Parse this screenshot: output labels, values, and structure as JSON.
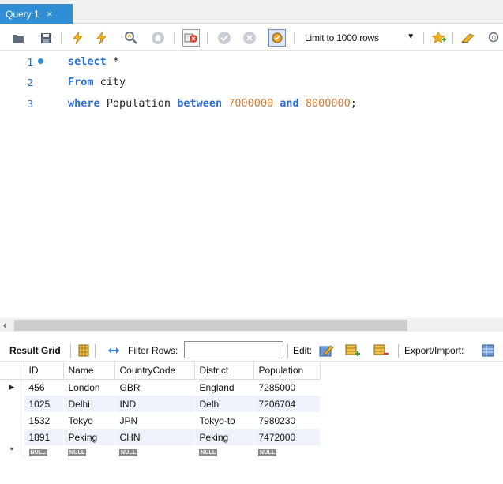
{
  "tabs": [
    {
      "label": "Query 1",
      "close": "×"
    }
  ],
  "toolbar": {
    "limit_label": "Limit to 1000 rows",
    "icons": [
      "folder-icon",
      "save-icon",
      "execute-icon",
      "execute-current-icon",
      "explain-icon",
      "stop-icon",
      "toggle-error-icon",
      "commit-icon",
      "rollback-icon",
      "autocommit-icon",
      "bookmark-icon",
      "beautify-icon",
      "find-icon"
    ]
  },
  "editor": {
    "lines": [
      {
        "num": "1",
        "tokens": [
          {
            "t": "select",
            "k": "kw"
          },
          {
            "t": " *",
            "k": "txt"
          }
        ]
      },
      {
        "num": "2",
        "tokens": [
          {
            "t": "From",
            "k": "kw"
          },
          {
            "t": " city",
            "k": "txt"
          }
        ]
      },
      {
        "num": "3",
        "tokens": [
          {
            "t": "where",
            "k": "kw"
          },
          {
            "t": " Population ",
            "k": "txt"
          },
          {
            "t": "between",
            "k": "kw"
          },
          {
            "t": " ",
            "k": "txt"
          },
          {
            "t": "7000000",
            "k": "num"
          },
          {
            "t": " ",
            "k": "txt"
          },
          {
            "t": "and",
            "k": "kw"
          },
          {
            "t": " ",
            "k": "txt"
          },
          {
            "t": "8000000",
            "k": "num"
          },
          {
            "t": ";",
            "k": "txt"
          }
        ]
      }
    ]
  },
  "results_toolbar": {
    "result_grid": "Result Grid",
    "filter_rows": "Filter Rows:",
    "edit": "Edit:",
    "export_import": "Export/Import:"
  },
  "grid": {
    "columns": [
      "ID",
      "Name",
      "CountryCode",
      "District",
      "Population"
    ],
    "rows": [
      [
        "456",
        "London",
        "GBR",
        "England",
        "7285000"
      ],
      [
        "1025",
        "Delhi",
        "IND",
        "Delhi",
        "7206704"
      ],
      [
        "1532",
        "Tokyo",
        "JPN",
        "Tokyo-to",
        "7980230"
      ],
      [
        "1891",
        "Peking",
        "CHN",
        "Peking",
        "7472000"
      ]
    ],
    "null_label": "NULL"
  }
}
